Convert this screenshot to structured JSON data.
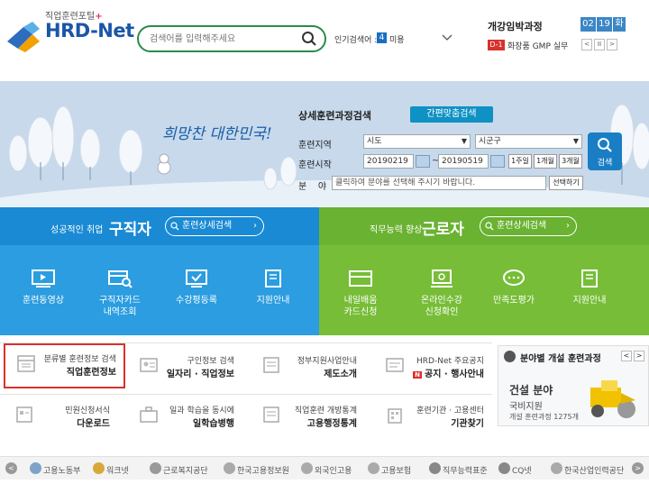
{
  "header": {
    "logo_sub": "직업훈련포털",
    "logo_plus": "+",
    "logo_main": "HRD-Net",
    "search_placeholder": "검색어를 입력해주세요",
    "popular_label": "인기검색어 :",
    "popular_rank": "4",
    "popular_word": "미용",
    "open_title": "개강임박과정",
    "open_month": "02",
    "open_day": "19",
    "open_weekday": "화",
    "d_badge": "D-1",
    "d_course": "화장품 GMP 실무",
    "ctrl_prev": "<",
    "ctrl_pause": "II",
    "ctrl_next": ">"
  },
  "banner": {
    "slogan": "희망찬 대한민국!",
    "panel_title": "상세훈련과정검색",
    "custom_search": "간편맞춤검색",
    "region_label": "훈련지역",
    "sido": "시도",
    "sigungu": "시군구",
    "start_label": "훈련시작",
    "date_from": "20190219",
    "date_sep": "~",
    "date_to": "20190519",
    "btn_1m": "1주일",
    "btn_2m": "1개월",
    "btn_3m": "3개월",
    "field_label": "분    야",
    "field_text": "클릭하여 분야를 선택해 주시기 바랍니다.",
    "field_btn": "선택하기",
    "search_btn": "검색"
  },
  "jobseeker": {
    "small": "성공적인 취업",
    "big": "구직자",
    "pill": "훈련상세검색",
    "services": [
      {
        "icon": "video-icon",
        "label": "훈련동영상",
        "label2": ""
      },
      {
        "icon": "card-search-icon",
        "label": "구직자카드",
        "label2": "내역조회"
      },
      {
        "icon": "check-screen-icon",
        "label": "수강평등록",
        "label2": ""
      },
      {
        "icon": "book-icon",
        "label": "지원안내",
        "label2": ""
      }
    ]
  },
  "worker": {
    "small": "직무능력 향상",
    "big": "근로자",
    "pill": "훈련상세검색",
    "services": [
      {
        "icon": "card-icon",
        "label": "내일배움",
        "label2": "카드신청"
      },
      {
        "icon": "online-icon",
        "label": "온라인수강",
        "label2": "신청확인"
      },
      {
        "icon": "chat-icon",
        "label": "만족도평가",
        "label2": ""
      },
      {
        "icon": "book-icon",
        "label": "지원안내",
        "label2": ""
      }
    ]
  },
  "tiles": [
    {
      "t1": "분류별 훈련정보 검색",
      "t2": "직업훈련정보"
    },
    {
      "t1": "구인정보 검색",
      "t2": "일자리 · 직업정보"
    },
    {
      "t1": "정부지원사업안내",
      "t2": "제도소개"
    },
    {
      "t1": "HRD-Net 주요공지",
      "t2": "공지 · 행사안내",
      "badge": "N"
    },
    {
      "t1": "민원신청서식",
      "t2": "다운로드"
    },
    {
      "t1": "일과 학습을 동시에",
      "t2": "일학습병행"
    },
    {
      "t1": "직업훈련 개방통계",
      "t2": "고용행정통계"
    },
    {
      "t1": "훈련기관 · 고용센터",
      "t2": "기관찾기"
    }
  ],
  "special": {
    "title": "분야별 개설 훈련과정",
    "prev": "<",
    "next": ">",
    "line1": "건설 분야",
    "line2": "국비지원",
    "line3": "개설 훈련과정 1275개"
  },
  "footer": {
    "prev": "<",
    "next": ">",
    "links": [
      "고용노동부",
      "워크넷",
      "근로복지공단",
      "한국고용정보원",
      "외국인고용",
      "고용보험",
      "직무능력표준",
      "CQ넷",
      "한국산업인력공단"
    ]
  },
  "colors": {
    "blue": "#1a8ad4",
    "green": "#6ab231",
    "brand": "#1a56a8",
    "red": "#d9312b"
  }
}
